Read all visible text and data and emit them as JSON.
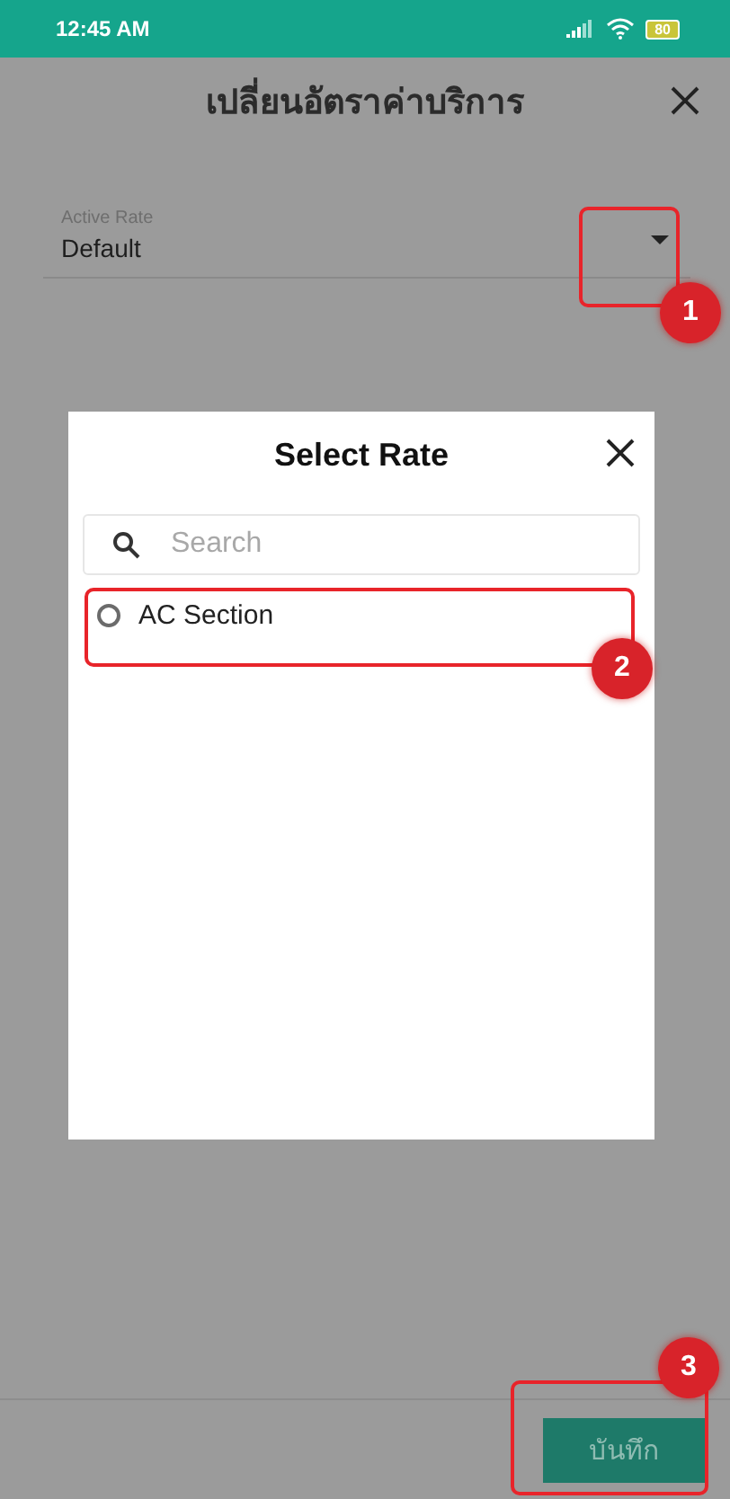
{
  "status_bar": {
    "time": "12:45 AM",
    "battery": "80"
  },
  "header": {
    "title": "เปลี่ยนอัตราค่าบริการ"
  },
  "field": {
    "label": "Active Rate",
    "value": "Default"
  },
  "dialog": {
    "title": "Select Rate",
    "search": {
      "placeholder": "Search"
    },
    "options": [
      {
        "label": "AC Section",
        "selected": false
      }
    ]
  },
  "footer": {
    "save_button": "บันทึก"
  },
  "annotations": [
    {
      "number": "1"
    },
    {
      "number": "2"
    },
    {
      "number": "3"
    }
  ]
}
